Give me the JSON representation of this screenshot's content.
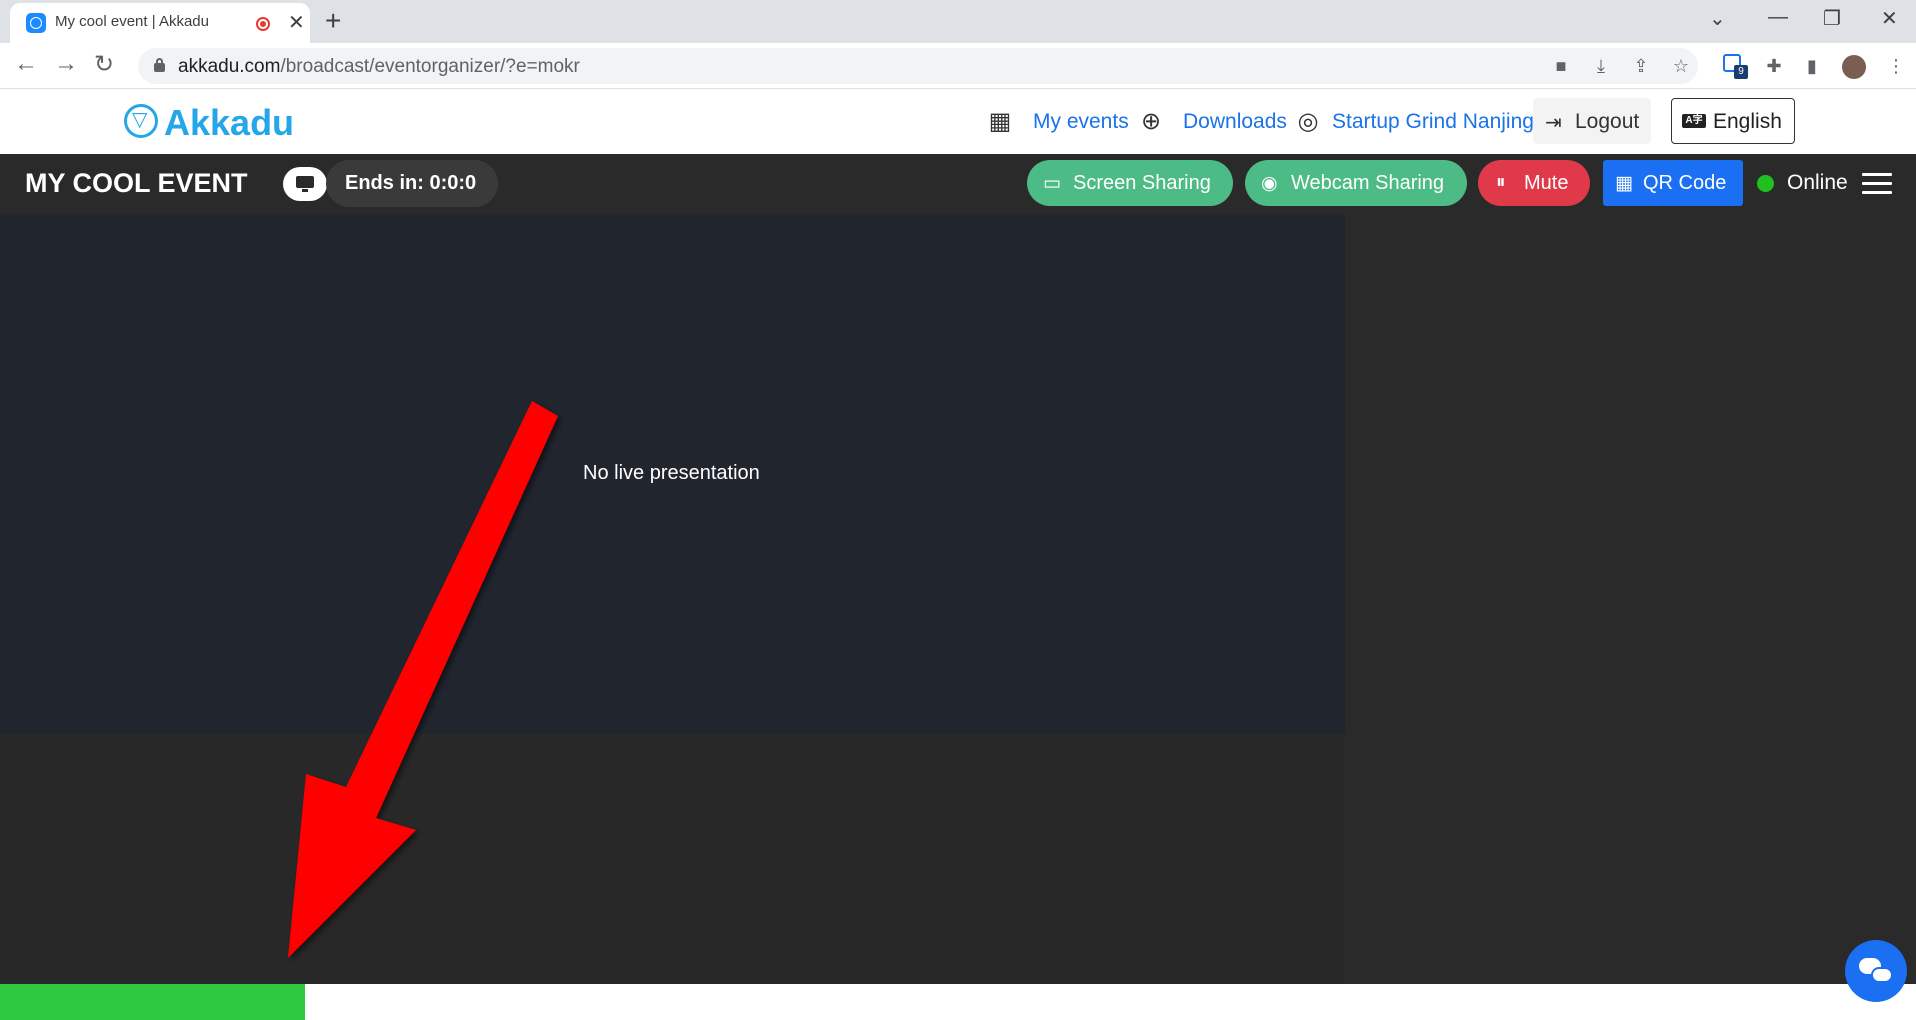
{
  "browser": {
    "tab_title": "My cool event | Akkadu",
    "tab_close": "✕",
    "new_tab": "+",
    "url_host": "akkadu.com",
    "url_path": "/broadcast/eventorganizer/?e=mokr",
    "extension_badge": "9",
    "window_controls": [
      "⌄",
      "—",
      "❐",
      "✕"
    ]
  },
  "header": {
    "logo": "Akkadu",
    "my_events": "My events",
    "downloads": "Downloads",
    "org_name": "Startup Grind Nanjing",
    "logout": "Logout",
    "language": "English",
    "lang_icon_text": "A字"
  },
  "event_bar": {
    "title": "MY COOL EVENT",
    "ends_in": "Ends in: 0:0:0",
    "screen_sharing": "Screen Sharing",
    "webcam_sharing": "Webcam Sharing",
    "mute": "Mute",
    "qr_code": "QR Code",
    "status": "Online"
  },
  "stage": {
    "message": "No live presentation"
  },
  "progress": {
    "fraction": 0.159
  },
  "colors": {
    "accent": "#24a6e8",
    "green_button": "#4cbb85",
    "mute_red": "#e03a4a",
    "qr_blue": "#1a6ff2",
    "online_green": "#20c020",
    "progress_green": "#2ec940",
    "annotation_arrow": "#ff0000"
  },
  "icons": {
    "calendar": "calendar-icon",
    "downloads": "download-circle-icon",
    "user": "user-circle-icon",
    "logout": "logout-icon",
    "screen_sharing": "monitor-icon",
    "webcam": "webcam-icon",
    "mute": "pause-circle-icon",
    "qr": "qr-code-icon",
    "menu": "hamburger-menu-icon",
    "chat": "chat-bubbles-icon"
  }
}
